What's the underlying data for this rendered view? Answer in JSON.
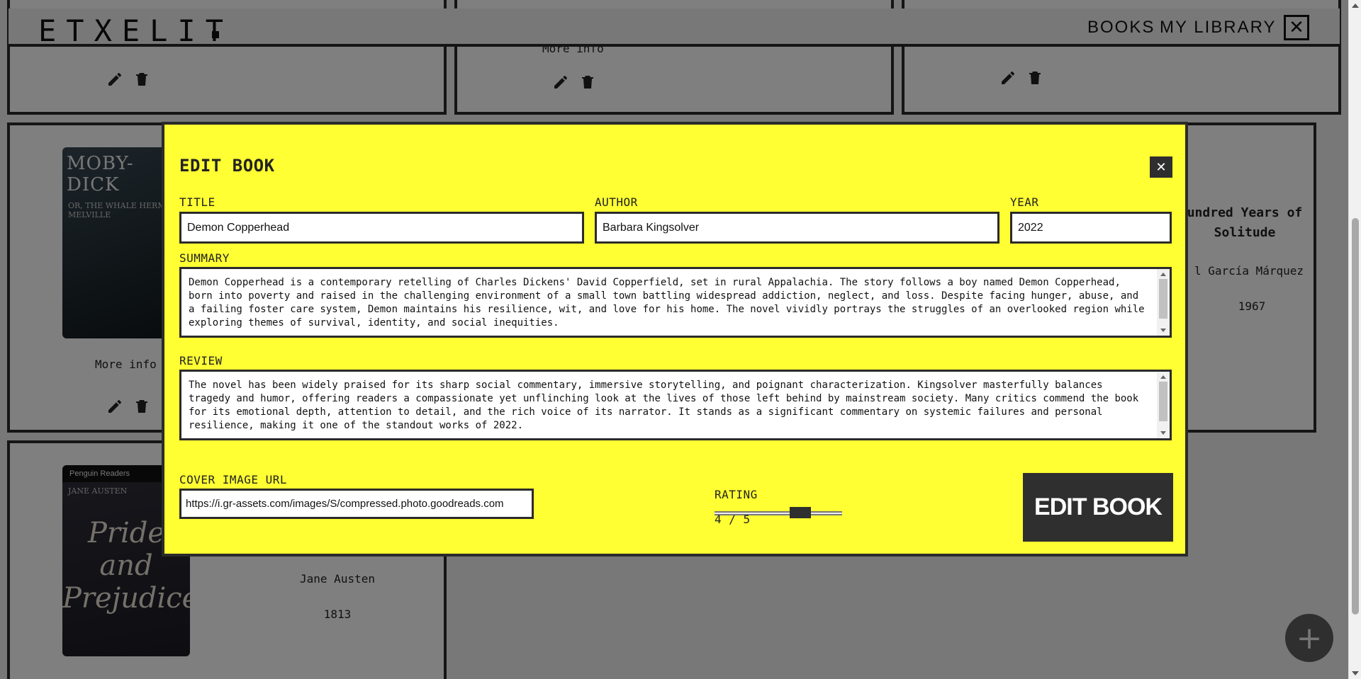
{
  "app": {
    "logo": "ETXELIT"
  },
  "nav": {
    "books": "BOOKS",
    "my_library": "MY LIBRARY",
    "close": "✕"
  },
  "cards": {
    "moby_dick": {
      "cover_title": "MOBY-DICK",
      "cover_subtitle": "OR, THE WHALE  HERMAN MELVILLE",
      "more_info": "More info"
    },
    "pride": {
      "cover_publisher": "Penguin Readers",
      "cover_author": "JANE AUSTEN",
      "cover_title": "Pride and Prejudice",
      "author": "Jane Austen",
      "year": "1813"
    },
    "solitude": {
      "title": "undred Years of Solitude",
      "author": "l García Márquez",
      "year": "1967"
    },
    "top_middle_more_info": "More info"
  },
  "modal": {
    "title": "EDIT BOOK",
    "close": "✕",
    "title_label": "TITLE",
    "title_value": "Demon Copperhead",
    "author_label": "AUTHOR",
    "author_value": "Barbara Kingsolver",
    "year_label": "YEAR",
    "year_value": "2022",
    "summary_label": "SUMMARY",
    "summary_value": "Demon Copperhead is a contemporary retelling of Charles Dickens' David Copperfield, set in rural Appalachia. The story follows a boy named Demon Copperhead, born into poverty and raised in the challenging environment of a small town battling widespread addiction, neglect, and loss. Despite facing hunger, abuse, and a failing foster care system, Demon maintains his resilience, wit, and love for his home. The novel vividly portrays the struggles of an overlooked region while exploring themes of survival, identity, and social inequities.",
    "review_label": "REVIEW",
    "review_value": "The novel has been widely praised for its sharp social commentary, immersive storytelling, and poignant characterization. Kingsolver masterfully balances tragedy and humor, offering readers a compassionate yet unflinching look at the lives of those left behind by mainstream society. Many critics commend the book for its emotional depth, attention to detail, and the rich voice of its narrator. It stands as a significant commentary on systemic failures and personal resilience, making it one of the standout works of 2022.",
    "cover_label": "COVER IMAGE URL",
    "cover_value": "https://i.gr-assets.com/images/S/compressed.photo.goodreads.com",
    "rating_label": "RATING",
    "rating": 4,
    "rating_max": 5,
    "rating_text": "4 / 5",
    "submit": "EDIT BOOK"
  },
  "fab": "+",
  "colors": {
    "modal_bg": "#ffff33",
    "dark": "#2f2f2f"
  }
}
